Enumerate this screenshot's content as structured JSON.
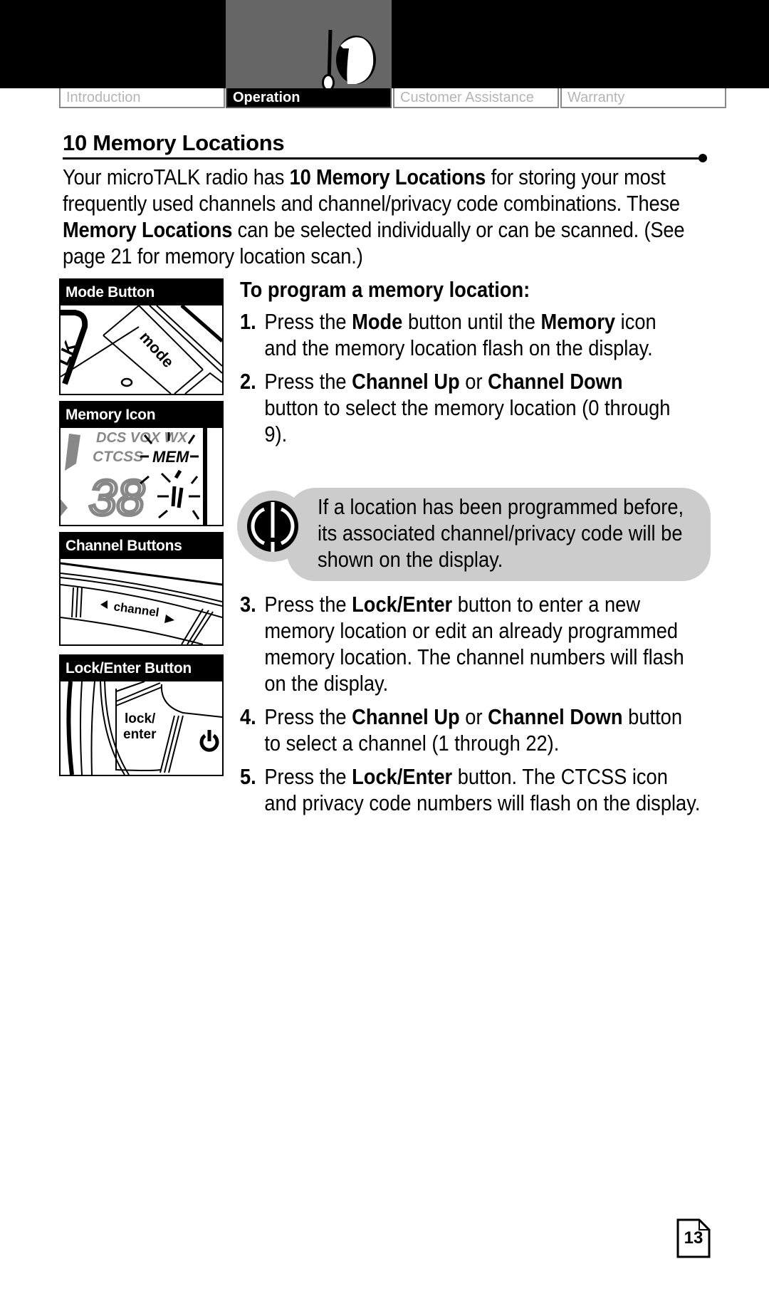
{
  "nav": {
    "tabs": [
      {
        "label": "Introduction",
        "active": false
      },
      {
        "label": "Operation",
        "active": true
      },
      {
        "label": "Customer Assistance",
        "active": false
      },
      {
        "label": "Warranty",
        "active": false
      }
    ],
    "section_icon": "radio-icon"
  },
  "section": {
    "title": "10 Memory Locations",
    "intro": {
      "p1": "Your microTALK radio has ",
      "b1": "10 Memory Locations",
      "p2": " for storing your most frequently used channels and channel/privacy code combinations. These ",
      "b2": "Memory Locations",
      "p3": " can be selected individually or can be scanned. (See page 21 for memory location scan.)"
    }
  },
  "sidebar": {
    "figures": [
      {
        "caption": "Mode Button",
        "button_text": "mode"
      },
      {
        "caption": "Memory Icon",
        "display_labels": [
          "DCS VOX WX",
          "CTCSS",
          "MEM",
          "38",
          "1"
        ]
      },
      {
        "caption": "Channel Buttons",
        "button_text": "channel"
      },
      {
        "caption": "Lock/Enter Button",
        "button_text": [
          "lock/",
          "enter"
        ]
      }
    ]
  },
  "procedure": {
    "subtitle": "To program a memory location:",
    "steps": [
      {
        "num": "1.",
        "t1": "Press the ",
        "b1": "Mode",
        "t2": " button until the ",
        "b2": "Memory",
        "t3": " icon and the memory location flash on the display."
      },
      {
        "num": "2.",
        "t1": "Press the ",
        "b1": "Channel Up",
        "t2": " or ",
        "b2": "Channel Down",
        "t3": " button to select the memory location (0 through 9)."
      },
      {
        "num": "3.",
        "t1": "Press the ",
        "b1": "Lock/Enter",
        "t2": " button to enter a new memory location or edit an already programmed memory location. The channel numbers will flash on the display."
      },
      {
        "num": "4.",
        "t1": "Press the ",
        "b1": "Channel Up",
        "t2": " or ",
        "b2": "Channel Down",
        "t3": " button to select a channel (1 through 22)."
      },
      {
        "num": "5.",
        "t1": "Press the ",
        "b1": "Lock/Enter",
        "t2": " button. The CTCSS icon and privacy code numbers will flash on the display."
      }
    ],
    "note": {
      "icon": "info-icon",
      "text": "If a location has been programmed before, its associated channel/privacy code will be shown on the display."
    }
  },
  "footer": {
    "page_number": "13"
  }
}
